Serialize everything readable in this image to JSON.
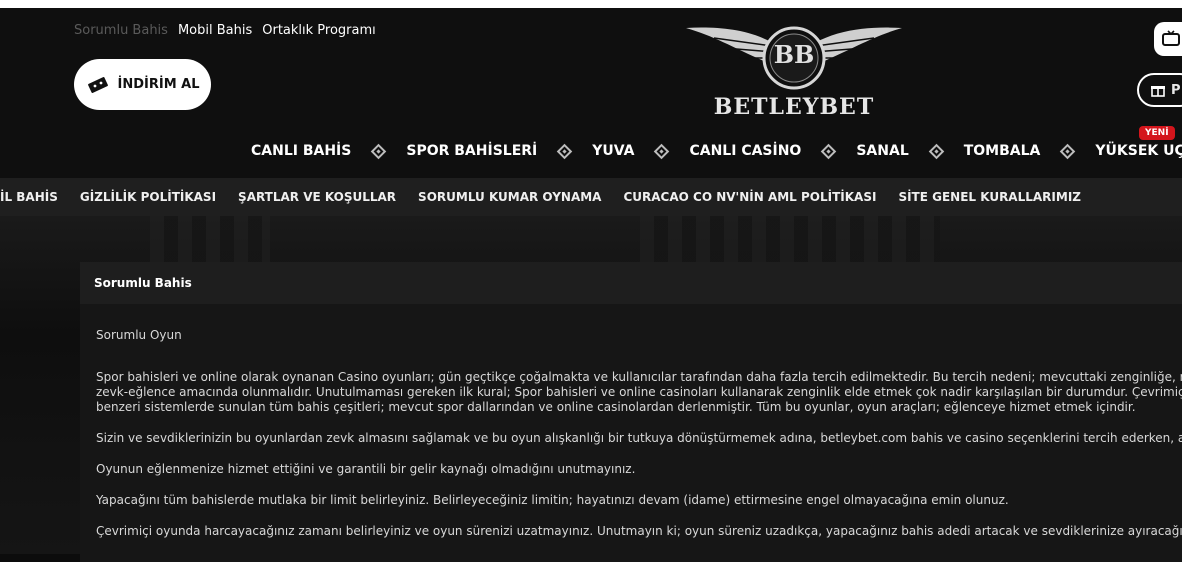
{
  "header": {
    "top_links": [
      {
        "label": "Sorumlu Bahis",
        "active": true
      },
      {
        "label": "Mobil Bahis"
      },
      {
        "label": "Ortaklık Programı"
      }
    ],
    "discount_button": "İNDİRİM AL",
    "logo_text": "BETLEYBET",
    "logo_monogram": "BB",
    "right_button_label": "P"
  },
  "main_nav": [
    "CANLI BAHİS",
    "SPOR BAHİSLERİ",
    "YUVA",
    "CANLI CASİNO",
    "SANAL",
    "TOMBALA",
    "YÜKSEK UÇAN"
  ],
  "new_badge": "YENİ",
  "sub_nav": [
    "İL BAHİS",
    "GİZLİLİK POLİTİKASI",
    "ŞARTLAR VE KOŞULLAR",
    "SORUMLU KUMAR OYNAMA",
    "CURACAO CO NV'NİN AML POLİTİKASI",
    "SİTE GENEL KURALLARIMIZ"
  ],
  "panel": {
    "title": "Sorumlu Bahis",
    "subtitle": "Sorumlu Oyun",
    "paragraph1": [
      "Spor bahisleri ve online olarak oynanan Casino oyunları; gün geçtikçe çoğalmakta ve kullanıcılar tarafından daha fazla tercih edilmektedir. Bu tercih nedeni; mevcuttaki zenginliğe, ma",
      "zevk-eğlence amacında olunmalıdır. Unutulmaması gereken ilk kural; Spor bahisleri ve online casinoları kullanarak zenginlik elde etmek çok nadir karşılaşılan bir durumdur. Çevrimiçi C",
      "benzeri sistemlerde sunulan tüm bahis çeşitleri; mevcut spor dallarından ve online casinolardan derlenmiştir. Tüm bu oyunlar, oyun araçları; eğlenceye hizmet etmek içindir."
    ],
    "paragraph2": "Sizin ve sevdiklerinizin bu oyunlardan zevk almasını sağlamak ve bu oyun alışkanlığı bir tutkuya dönüştürmemek adına, betleybet.com bahis ve casino seçenklerini tercih ederken, aşa",
    "paragraph3": "Oyunun eğlenmenize hizmet ettiğini ve garantili bir gelir kaynağı olmadığını unutmayınız.",
    "paragraph4": "Yapacağını tüm bahislerde mutlaka bir limit belirleyiniz. Belirleyeceğiniz limitin; hayatınızı devam (idame) ettirmesine engel olmayacağına emin olunuz.",
    "paragraph5": "Çevrimiçi oyunda harcayacağınız zamanı belirleyiniz ve oyun sürenizi uzatmayınız. Unutmayın ki; oyun süreniz uzadıkça, yapacağınız bahis adedi artacak ve sevdiklerinize ayıracağın"
  },
  "icons": {
    "discount": "ticket-icon",
    "top_right": "tv-icon",
    "gift": "gift-icon",
    "separator": "diamond-icon"
  }
}
